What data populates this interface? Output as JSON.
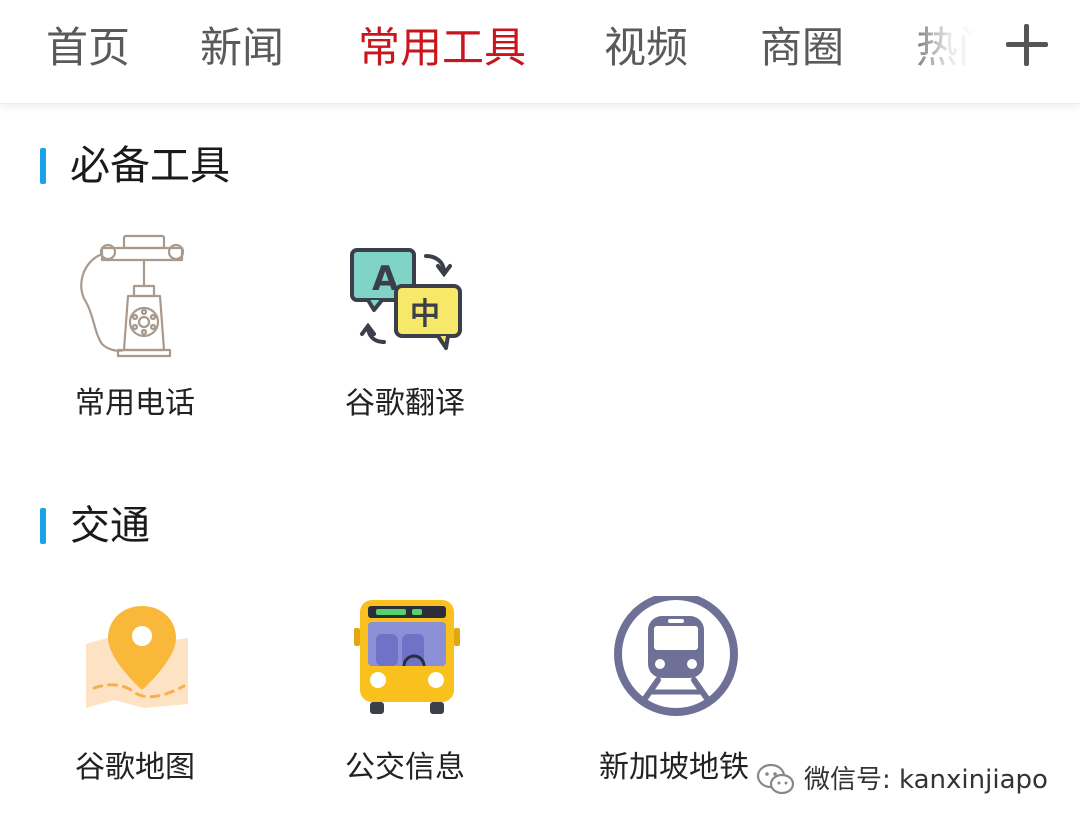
{
  "nav": {
    "tabs": [
      {
        "label": "首页"
      },
      {
        "label": "新闻"
      },
      {
        "label": "常用工具"
      },
      {
        "label": "视频"
      },
      {
        "label": "商圈"
      },
      {
        "label": "热门"
      }
    ],
    "active_tab": "常用工具",
    "add_icon": "plus-icon",
    "active_color": "#c8161d"
  },
  "sections": [
    {
      "title": "必备工具",
      "items": [
        {
          "label": "常用电话",
          "icon": "telephone-icon"
        },
        {
          "label": "谷歌翻译",
          "icon": "translate-icon"
        }
      ]
    },
    {
      "title": "交通",
      "items": [
        {
          "label": "谷歌地图",
          "icon": "map-pin-icon"
        },
        {
          "label": "公交信息",
          "icon": "bus-icon"
        },
        {
          "label": "新加坡地铁",
          "icon": "metro-train-icon"
        }
      ]
    }
  ],
  "accent_color": "#19a2e6",
  "watermark": {
    "text": "微信号: kanxinjiapo",
    "icon": "wechat-icon"
  }
}
